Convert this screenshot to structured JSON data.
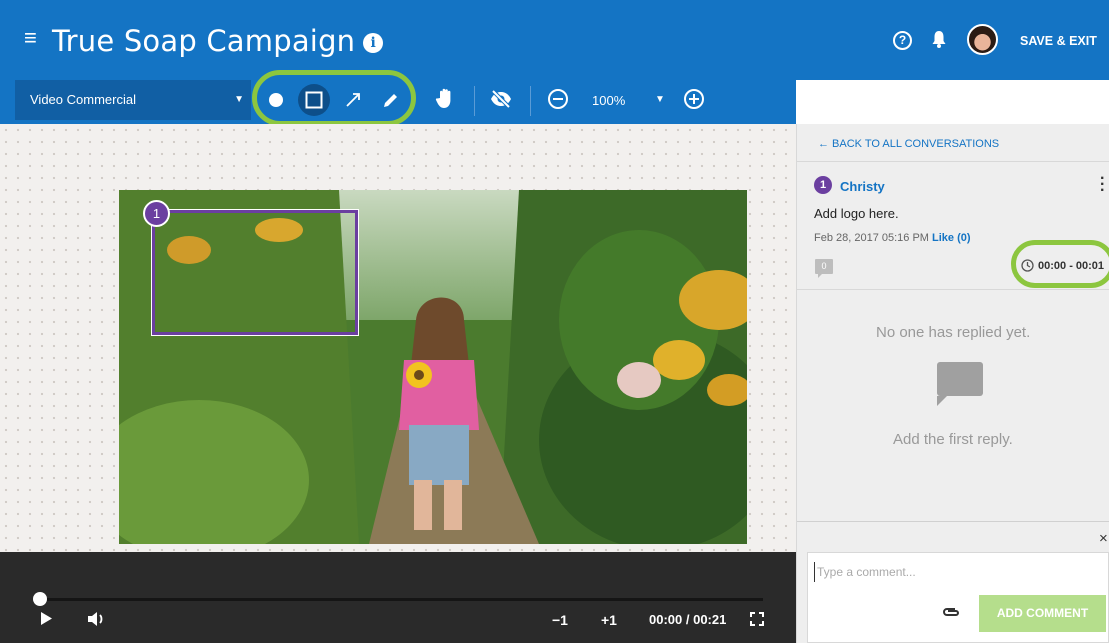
{
  "header": {
    "title": "True Soap Campaign",
    "save_exit_label": "SAVE & EXIT"
  },
  "toolbar": {
    "asset_select_value": "Video Commercial",
    "zoom_level": "100%",
    "tools": [
      "circle-tool",
      "rectangle-tool",
      "arrow-tool",
      "pen-tool",
      "pan-tool",
      "hide-annotations-tool"
    ],
    "active_tool": "rectangle-tool"
  },
  "annotation": {
    "pin_number": "1"
  },
  "player": {
    "rewind_label": "−1",
    "forward_label": "+1",
    "time_display": "00:00 / 00:21",
    "progress_fraction": 0.0
  },
  "sidebar": {
    "back_label": "← BACK TO ALL CONVERSATIONS",
    "comment": {
      "pin_number": "1",
      "author": "Christy",
      "text": "Add logo here.",
      "date": "Feb 28, 2017 05:16 PM",
      "like_label": "Like (0)",
      "reply_count": "0",
      "time_range": "00:00 - 00:01"
    },
    "no_replies": "No one has replied yet.",
    "first_reply": "Add the first reply.",
    "compose_placeholder": "Type a comment...",
    "add_comment_label": "ADD COMMENT",
    "close_label": "×"
  },
  "colors": {
    "brand_blue": "#1474c4",
    "highlight_green": "#8cc63f",
    "annotation_purple": "#6b3fa0",
    "button_disabled_green": "#b5de8c"
  }
}
